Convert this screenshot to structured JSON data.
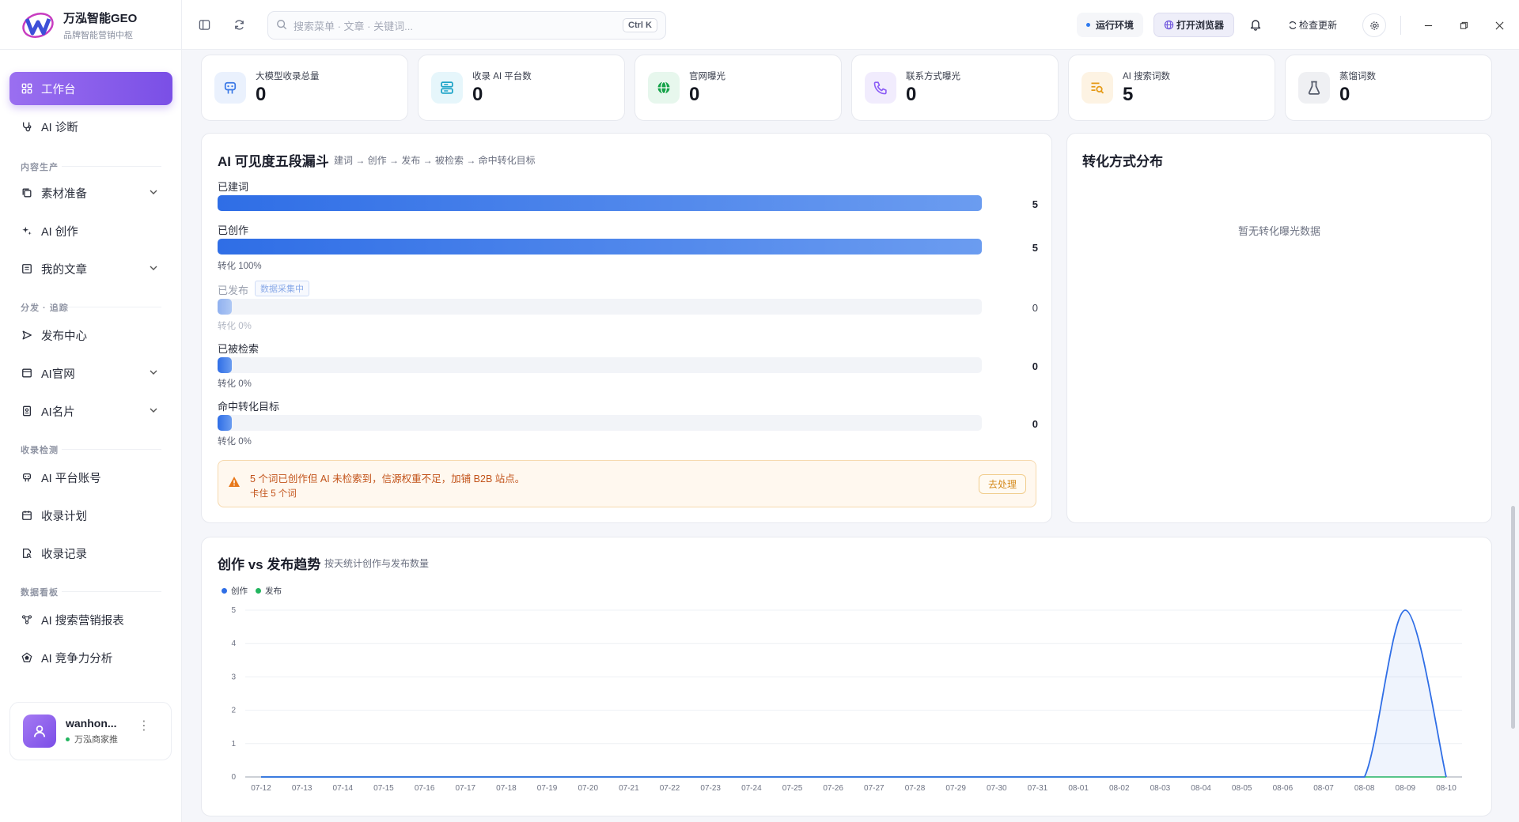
{
  "brand": {
    "name": "万泓智能GEO",
    "tagline": "品牌智能营销中枢"
  },
  "header": {
    "search_placeholder": "搜索菜单 · 文章 · 关键词...",
    "search_shortcut": "Ctrl K",
    "env_label": "运行环境",
    "browser_label": "打开浏览器",
    "update_label": "检查更新"
  },
  "sidebar": {
    "items": [
      {
        "label": "工作台"
      },
      {
        "label": "AI 诊断"
      },
      {
        "label": "素材准备"
      },
      {
        "label": "AI 创作"
      },
      {
        "label": "我的文章"
      },
      {
        "label": "发布中心"
      },
      {
        "label": "AI官网"
      },
      {
        "label": "AI名片"
      },
      {
        "label": "AI 平台账号"
      },
      {
        "label": "收录计划"
      },
      {
        "label": "收录记录"
      },
      {
        "label": "AI 搜索营销报表"
      },
      {
        "label": "AI 竞争力分析"
      }
    ],
    "sections": [
      "内容生产",
      "分发 · 追踪",
      "收录检测",
      "数据看板"
    ],
    "user": {
      "name": "wanhon...",
      "company": "万泓商家推"
    }
  },
  "stats": [
    {
      "label": "大模型收录总量",
      "value": "0",
      "icon": "robot-icon",
      "color": "#3a78e6"
    },
    {
      "label": "收录 AI 平台数",
      "value": "0",
      "icon": "server-icon",
      "color": "#1ea4c8"
    },
    {
      "label": "官网曝光",
      "value": "0",
      "icon": "globe-icon",
      "color": "#16a34a"
    },
    {
      "label": "联系方式曝光",
      "value": "0",
      "icon": "phone-icon",
      "color": "#8b5cf6"
    },
    {
      "label": "AI 搜索词数",
      "value": "5",
      "icon": "search-list-icon",
      "color": "#e59a16"
    },
    {
      "label": "蒸馏词数",
      "value": "0",
      "icon": "flask-icon",
      "color": "#555b6b"
    }
  ],
  "funnel": {
    "title": "AI 可见度五段漏斗",
    "subtitle": "建词 → 创作 → 发布 → 被检索 → 命中转化目标",
    "stages": [
      {
        "label": "已建词",
        "value": "5",
        "fraction": 1.0,
        "rate": ""
      },
      {
        "label": "已创作",
        "value": "5",
        "fraction": 1.0,
        "rate": "转化 100%"
      },
      {
        "label": "已发布",
        "value": "0",
        "fraction": 0.0,
        "rate": "转化 0%",
        "tag": "数据采集中"
      },
      {
        "label": "已被检索",
        "value": "0",
        "fraction": 0.0,
        "rate": "转化 0%"
      },
      {
        "label": "命中转化目标",
        "value": "0",
        "fraction": 0.0,
        "rate": "转化 0%"
      }
    ],
    "warning": {
      "text": "5 个词已创作但 AI 未检索到，信源权重不足，加铺 B2B 站点。",
      "sub": "卡住 5 个词",
      "action": "去处理"
    }
  },
  "conversion": {
    "title": "转化方式分布",
    "empty": "暂无转化曝光数据"
  },
  "trend": {
    "title": "创作 vs 发布趋势",
    "subtitle": "按天统计创作与发布数量"
  },
  "chart_data": {
    "type": "area",
    "title": "创作 vs 发布趋势",
    "x": [
      "07-12",
      "07-13",
      "07-14",
      "07-15",
      "07-16",
      "07-17",
      "07-18",
      "07-19",
      "07-20",
      "07-21",
      "07-22",
      "07-23",
      "07-24",
      "07-25",
      "07-26",
      "07-27",
      "07-28",
      "07-29",
      "07-30",
      "07-31",
      "08-01",
      "08-02",
      "08-03",
      "08-04",
      "08-05",
      "08-06",
      "08-07",
      "08-08",
      "08-09",
      "08-10"
    ],
    "series": [
      {
        "name": "创作",
        "color": "#2f6ee6",
        "values": [
          0,
          0,
          0,
          0,
          0,
          0,
          0,
          0,
          0,
          0,
          0,
          0,
          0,
          0,
          0,
          0,
          0,
          0,
          0,
          0,
          0,
          0,
          0,
          0,
          0,
          0,
          0,
          0,
          5,
          0
        ]
      },
      {
        "name": "发布",
        "color": "#22b55e",
        "values": [
          0,
          0,
          0,
          0,
          0,
          0,
          0,
          0,
          0,
          0,
          0,
          0,
          0,
          0,
          0,
          0,
          0,
          0,
          0,
          0,
          0,
          0,
          0,
          0,
          0,
          0,
          0,
          0,
          0,
          0
        ]
      }
    ],
    "ylim": [
      0,
      5
    ],
    "yticks": [
      0,
      1,
      2,
      3,
      4,
      5
    ],
    "grid": true,
    "legend": "top-left"
  }
}
